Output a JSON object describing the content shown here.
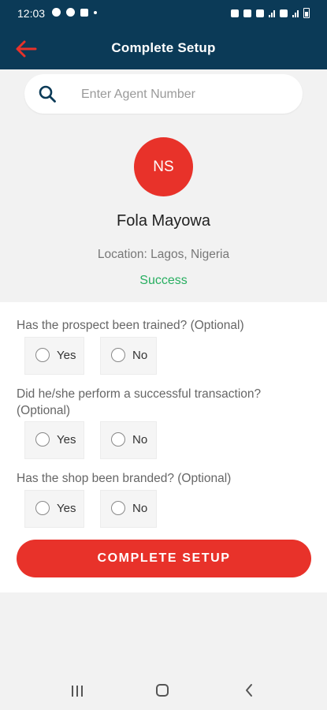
{
  "status_bar": {
    "time": "12:03"
  },
  "header": {
    "title": "Complete Setup",
    "back_icon": "arrow-left-icon"
  },
  "search": {
    "placeholder": "Enter Agent Number",
    "value": "",
    "icon": "search-icon"
  },
  "agent": {
    "initials": "NS",
    "name": "Fola Mayowa",
    "location": "Location: Lagos, Nigeria",
    "status": "Success"
  },
  "questions": [
    {
      "text": "Has the prospect been trained? (Optional)",
      "yes": "Yes",
      "no": "No"
    },
    {
      "text": "Did he/she perform a successful transaction? (Optional)",
      "yes": "Yes",
      "no": "No"
    },
    {
      "text": "Has the shop been branded? (Optional)",
      "yes": "Yes",
      "no": "No"
    }
  ],
  "cta": {
    "label": "COMPLETE SETUP"
  },
  "colors": {
    "header": "#0b3a57",
    "accent": "#e8322a",
    "success": "#27ae60",
    "background": "#f2f2f2"
  }
}
